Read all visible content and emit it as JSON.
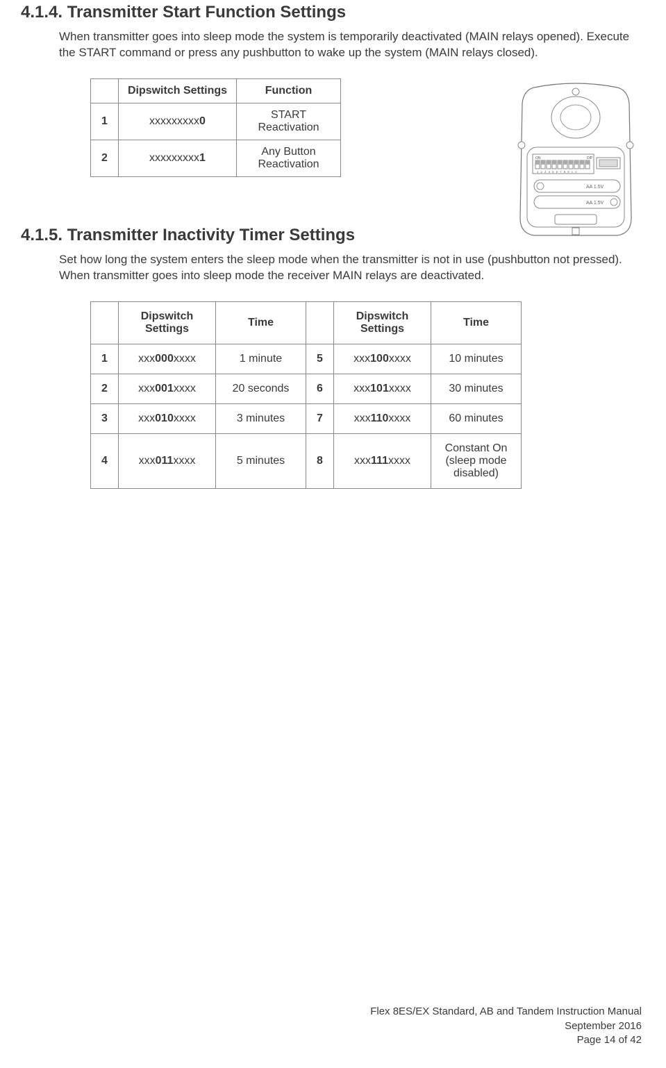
{
  "section414": {
    "heading": "4.1.4. Transmitter Start Function Settings",
    "para": "When transmitter goes into sleep mode the system is temporarily deactivated (MAIN relays opened).  Execute the START command or press any pushbutton to wake up the system (MAIN relays closed).",
    "headers": {
      "blank": "",
      "dip": "Dipswitch Settings",
      "func": "Function"
    },
    "rows": [
      {
        "n": "1",
        "dip_pre": "xxxxxxxxx",
        "dip_b": "0",
        "func": "START Reactivation"
      },
      {
        "n": "2",
        "dip_pre": "xxxxxxxxx",
        "dip_b": "1",
        "func": "Any Button Reactivation"
      }
    ]
  },
  "section415": {
    "heading": "4.1.5. Transmitter Inactivity Timer Settings",
    "para": "Set how long the system enters the sleep mode when the transmitter is not in use (pushbutton not pressed).  When transmitter goes into sleep mode the receiver MAIN relays are deactivated.",
    "headers": {
      "dip": "Dipswitch Settings",
      "time": "Time"
    },
    "rows": [
      {
        "n": "1",
        "dpre": "xxx",
        "db": "000",
        "dpost": "xxxx",
        "time": "1 minute",
        "n2": "5",
        "d2pre": "xxx",
        "d2b": "100",
        "d2post": "xxxx",
        "time2": "10 minutes"
      },
      {
        "n": "2",
        "dpre": "xxx",
        "db": "001",
        "dpost": "xxxx",
        "time": "20 seconds",
        "n2": "6",
        "d2pre": "xxx",
        "d2b": "101",
        "d2post": "xxxx",
        "time2": "30 minutes"
      },
      {
        "n": "3",
        "dpre": "xxx",
        "db": "010",
        "dpost": "xxxx",
        "time": "3 minutes",
        "n2": "7",
        "d2pre": "xxx",
        "d2b": "110",
        "d2post": "xxxx",
        "time2": "60 minutes"
      },
      {
        "n": "4",
        "dpre": "xxx",
        "db": "011",
        "dpost": "xxxx",
        "time": "5 minutes",
        "n2": "8",
        "d2pre": "xxx",
        "d2b": "111",
        "d2post": "xxxx",
        "time2": "Constant On (sleep mode disabled)"
      }
    ]
  },
  "device": {
    "on": "ON",
    "dip": "DIP",
    "nums": [
      "1",
      "2",
      "3",
      "4",
      "5",
      "6",
      "7",
      "8",
      "9",
      "10"
    ],
    "bat": "AA 1.5V"
  },
  "footer": {
    "l1": "Flex 8ES/EX Standard, AB and Tandem Instruction Manual",
    "l2": "September 2016",
    "l3": "Page 14 of 42"
  }
}
